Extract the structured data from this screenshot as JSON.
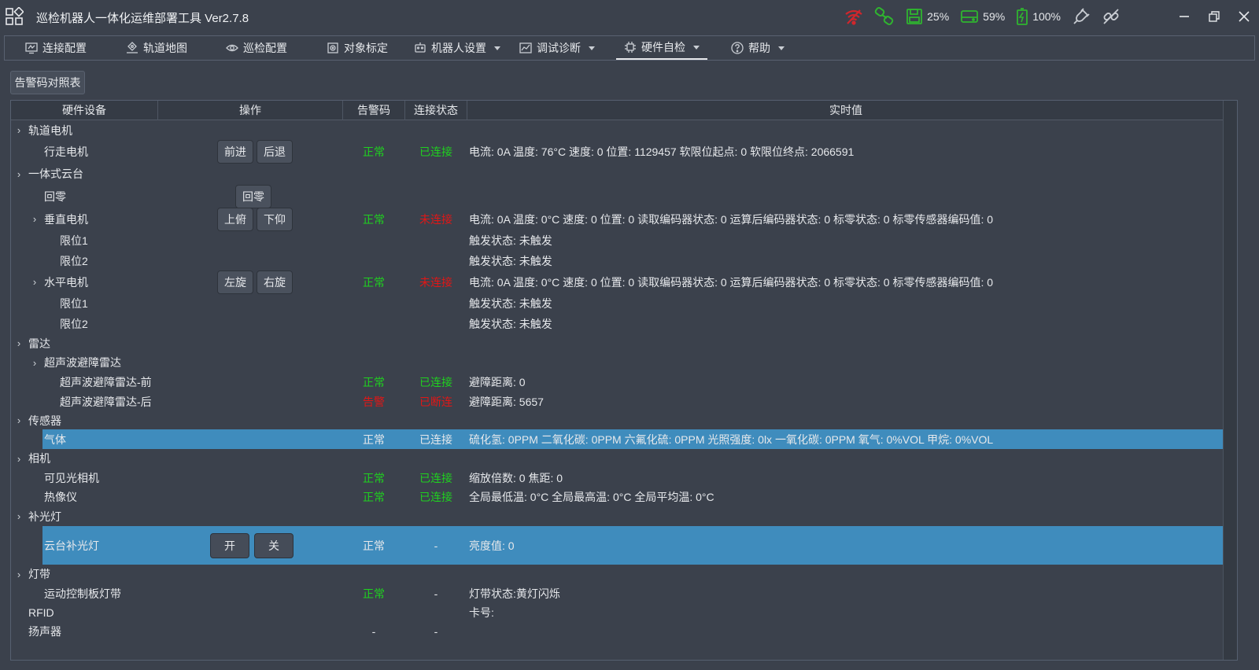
{
  "app": {
    "title": "巡检机器人一体化运维部署工具  Ver2.7.8",
    "status": {
      "storage": "25%",
      "memory": "59%",
      "battery": "100%"
    }
  },
  "tabs": [
    {
      "label": "连接配置",
      "icon": "monitor-icon"
    },
    {
      "label": "轨道地图",
      "icon": "map-icon"
    },
    {
      "label": "巡检配置",
      "icon": "eye-config-icon"
    },
    {
      "label": "对象标定",
      "icon": "target-icon"
    },
    {
      "label": "机器人设置",
      "icon": "robot-icon",
      "dropdown": true
    },
    {
      "label": "调试诊断",
      "icon": "chart-icon",
      "dropdown": true
    },
    {
      "label": "硬件自检",
      "icon": "chip-icon",
      "dropdown": true,
      "active": true
    },
    {
      "label": "帮助",
      "icon": "help-icon",
      "dropdown": true
    }
  ],
  "alarm_table_button": "告警码对照表",
  "table": {
    "columns": [
      "硬件设备",
      "操作",
      "告警码",
      "连接状态",
      "实时值"
    ],
    "rows": [
      {
        "name": "轨道电机",
        "level": 0,
        "expandable": true
      },
      {
        "name": "行走电机",
        "level": 1,
        "ops": [
          "前进",
          "后退"
        ],
        "alarm": "正常",
        "alarm_color": "green",
        "conn": "已连接",
        "conn_color": "green",
        "value": "电流: 0A 温度: 76°C 速度: 0 位置: 1129457 软限位起点: 0 软限位终点: 2066591"
      },
      {
        "name": "一体式云台",
        "level": 0,
        "expandable": true
      },
      {
        "name": "回零",
        "level": 1,
        "ops": [
          "回零"
        ]
      },
      {
        "name": "垂直电机",
        "level": 1,
        "expandable": true,
        "ops": [
          "上俯",
          "下仰"
        ],
        "alarm": "正常",
        "alarm_color": "green",
        "conn": "未连接",
        "conn_color": "red",
        "value": "电流: 0A 温度: 0°C 速度: 0 位置: 0 读取编码器状态: 0 运算后编码器状态: 0 标零状态: 0 标零传感器编码值: 0"
      },
      {
        "name": "限位1",
        "level": 2,
        "value": "触发状态: 未触发"
      },
      {
        "name": "限位2",
        "level": 2,
        "value": "触发状态: 未触发"
      },
      {
        "name": "水平电机",
        "level": 1,
        "expandable": true,
        "ops": [
          "左旋",
          "右旋"
        ],
        "alarm": "正常",
        "alarm_color": "green",
        "conn": "未连接",
        "conn_color": "red",
        "value": "电流: 0A 温度: 0°C 速度: 0 位置: 0 读取编码器状态: 0 运算后编码器状态: 0 标零状态: 0 标零传感器编码值: 0"
      },
      {
        "name": "限位1",
        "level": 2,
        "value": "触发状态: 未触发"
      },
      {
        "name": "限位2",
        "level": 2,
        "value": "触发状态: 未触发"
      },
      {
        "name": "雷达",
        "level": 0,
        "expandable": true
      },
      {
        "name": "超声波避障雷达",
        "level": 1,
        "expandable": true
      },
      {
        "name": "超声波避障雷达-前",
        "level": 2,
        "alarm": "正常",
        "alarm_color": "green",
        "conn": "已连接",
        "conn_color": "green",
        "value": "避障距离: 0"
      },
      {
        "name": "超声波避障雷达-后",
        "level": 2,
        "alarm": "告警",
        "alarm_color": "red",
        "conn": "已断连",
        "conn_color": "red",
        "value": "避障距离: 5657"
      },
      {
        "name": "传感器",
        "level": 0,
        "expandable": true
      },
      {
        "name": "气体",
        "level": 1,
        "selected": true,
        "alarm": "正常",
        "conn": "已连接",
        "value": "硫化氢: 0PPM 二氧化碳: 0PPM 六氟化硫: 0PPM 光照强度: 0lx 一氧化碳: 0PPM 氧气: 0%VOL 甲烷: 0%VOL"
      },
      {
        "name": "相机",
        "level": 0,
        "expandable": true
      },
      {
        "name": "可见光相机",
        "level": 1,
        "alarm": "正常",
        "alarm_color": "green",
        "conn": "已连接",
        "conn_color": "green",
        "value": "缩放倍数: 0 焦距: 0"
      },
      {
        "name": "热像仪",
        "level": 1,
        "alarm": "正常",
        "alarm_color": "green",
        "conn": "已连接",
        "conn_color": "green",
        "value": "全局最低温: 0°C 全局最高温: 0°C 全局平均温: 0°C"
      },
      {
        "name": "补光灯",
        "level": 0,
        "expandable": true
      },
      {
        "name": "云台补光灯",
        "level": 1,
        "selected": true,
        "ops": [
          "开",
          "关"
        ],
        "big_ops": true,
        "alarm": "正常",
        "conn": "-",
        "value": "亮度值: 0"
      },
      {
        "name": "灯带",
        "level": 0,
        "expandable": true
      },
      {
        "name": "运动控制板灯带",
        "level": 1,
        "alarm": "正常",
        "alarm_color": "green",
        "conn": "-",
        "value": "灯带状态:黄灯闪烁"
      },
      {
        "name": "RFID",
        "level": 0,
        "value": "卡号:"
      },
      {
        "name": "扬声器",
        "level": 0,
        "alarm": "-",
        "conn": "-"
      }
    ]
  }
}
